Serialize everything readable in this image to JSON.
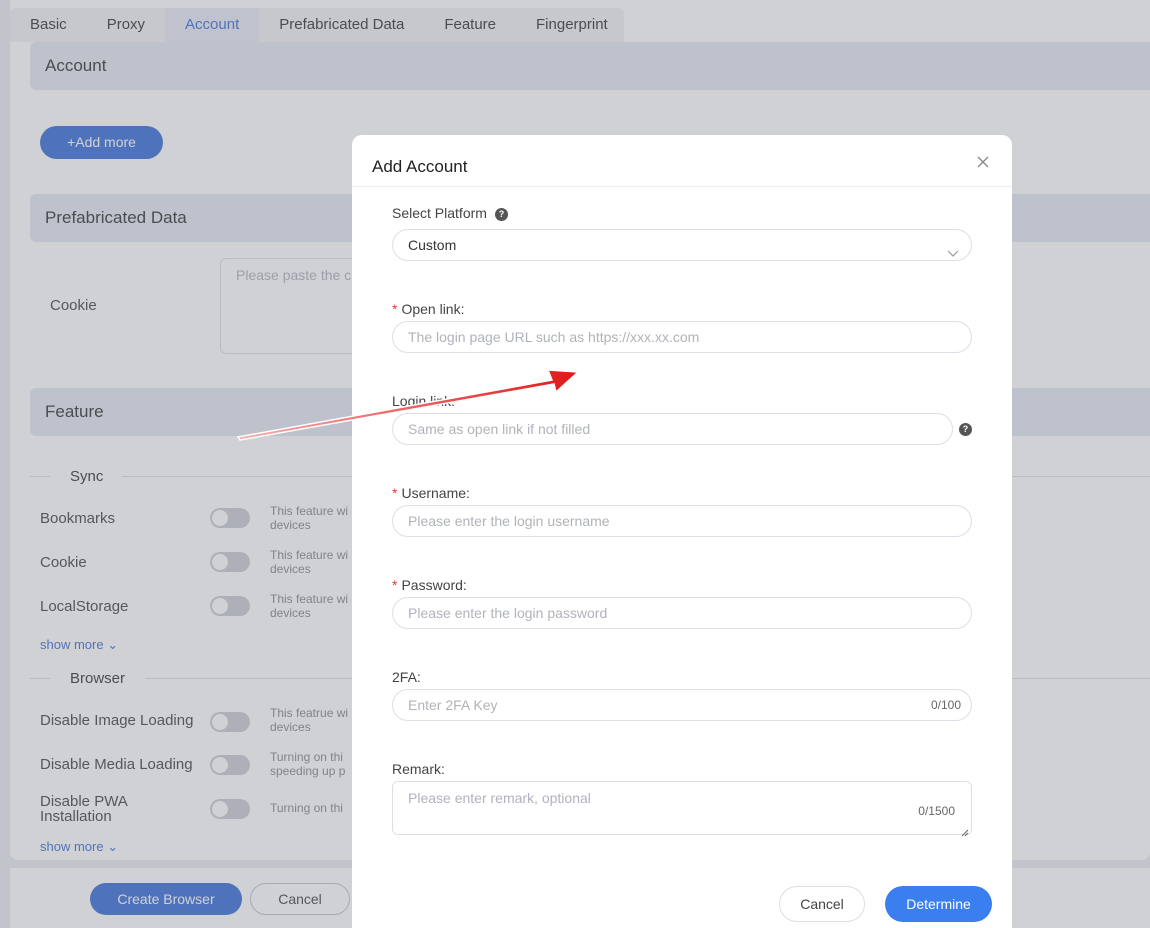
{
  "tabs": [
    "Basic",
    "Proxy",
    "Account",
    "Prefabricated Data",
    "Feature",
    "Fingerprint"
  ],
  "active_tab": "Account",
  "sections": {
    "account": "Account",
    "prefab": "Prefabricated Data",
    "feature": "Feature"
  },
  "add_more": "+Add more",
  "cookie": {
    "label": "Cookie",
    "placeholder": "Please paste the c"
  },
  "sync": {
    "title": "Sync",
    "items": [
      {
        "label": "Bookmarks",
        "desc1": "This feature wi",
        "desc2": "devices"
      },
      {
        "label": "Cookie",
        "desc1": "This feature wi",
        "desc2": "devices"
      },
      {
        "label": "LocalStorage",
        "desc1": "This feature wi",
        "desc2": "devices"
      }
    ],
    "show_more": "show more"
  },
  "browser": {
    "title": "Browser",
    "items": [
      {
        "label": "Disable Image Loading",
        "desc1": "This featrue wi",
        "desc2": "devices"
      },
      {
        "label": "Disable Media Loading",
        "desc1": "Turning on thi",
        "desc2": "speeding up p"
      },
      {
        "label1": "Disable PWA",
        "label2": "Installation",
        "desc1": "Turning on thi"
      }
    ],
    "show_more": "show more"
  },
  "footer": {
    "create": "Create Browser",
    "cancel": "Cancel"
  },
  "modal": {
    "title": "Add Account",
    "platform": {
      "label": "Select Platform",
      "value": "Custom"
    },
    "open_link": {
      "label": "Open link:",
      "placeholder": "The login page URL such as https://xxx.xx.com"
    },
    "login_link": {
      "label": "Login link:",
      "placeholder": "Same as open link if not filled"
    },
    "username": {
      "label": "Username:",
      "placeholder": "Please enter the login username"
    },
    "password": {
      "label": "Password:",
      "placeholder": "Please enter the login password"
    },
    "twofa": {
      "label": "2FA:",
      "placeholder": "Enter 2FA Key",
      "counter": "0/100"
    },
    "remark": {
      "label": "Remark:",
      "placeholder": "Please enter remark, optional",
      "counter": "0/1500"
    },
    "required_mark": "*",
    "help_glyph": "?",
    "cancel": "Cancel",
    "ok": "Determine"
  },
  "colors": {
    "accent": "#3a6fd8",
    "ok_button": "#3a7ef0",
    "annotation_arrow": "#e01818"
  }
}
